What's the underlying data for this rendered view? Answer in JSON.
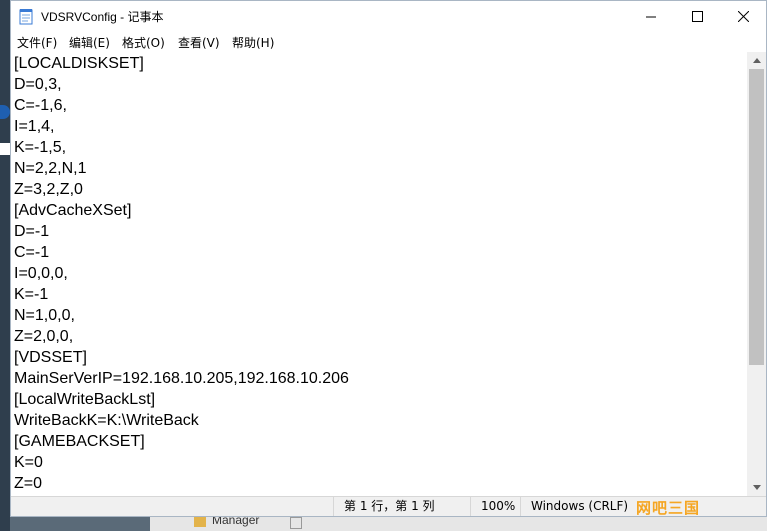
{
  "window": {
    "title": "VDSRVConfig - 记事本"
  },
  "menu": [
    "文件(F)",
    "编辑(E)",
    "格式(O)",
    "查看(V)",
    "帮助(H)"
  ],
  "lines": [
    "[LOCALDISKSET]",
    "D=0,3,",
    "C=-1,6,",
    "I=1,4,",
    "K=-1,5,",
    "N=2,2,N,1",
    "Z=3,2,Z,0",
    "[AdvCacheXSet]",
    "D=-1",
    "C=-1",
    "I=0,0,0,",
    "K=-1",
    "N=1,0,0,",
    "Z=2,0,0,",
    "[VDSSET]",
    "MainSerVerIP=192.168.10.205,192.168.10.206",
    "[LocalWriteBackLst]",
    "WriteBackK=K:\\WriteBack",
    "[GAMEBACKSET]",
    "K=0",
    "Z=0"
  ],
  "status": {
    "position": "第 1 行，第 1 列",
    "zoom": "100%",
    "encoding": "Windows (CRLF)"
  },
  "watermark": "网吧三国",
  "taskbar": {
    "item_label": "Manager"
  }
}
